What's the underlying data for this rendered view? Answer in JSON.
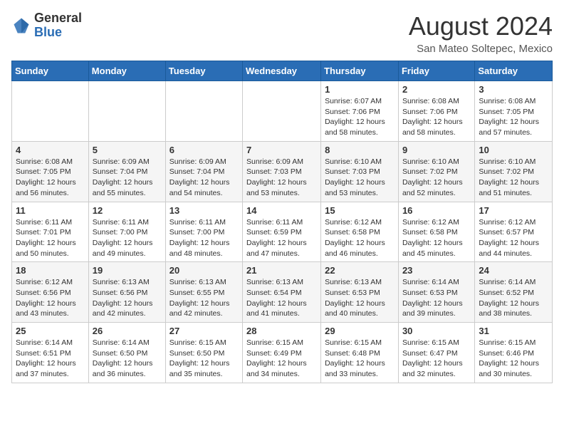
{
  "header": {
    "logo_general": "General",
    "logo_blue": "Blue",
    "month_title": "August 2024",
    "location": "San Mateo Soltepec, Mexico"
  },
  "days_of_week": [
    "Sunday",
    "Monday",
    "Tuesday",
    "Wednesday",
    "Thursday",
    "Friday",
    "Saturday"
  ],
  "weeks": [
    [
      {
        "day": "",
        "info": ""
      },
      {
        "day": "",
        "info": ""
      },
      {
        "day": "",
        "info": ""
      },
      {
        "day": "",
        "info": ""
      },
      {
        "day": "1",
        "info": "Sunrise: 6:07 AM\nSunset: 7:06 PM\nDaylight: 12 hours\nand 58 minutes."
      },
      {
        "day": "2",
        "info": "Sunrise: 6:08 AM\nSunset: 7:06 PM\nDaylight: 12 hours\nand 58 minutes."
      },
      {
        "day": "3",
        "info": "Sunrise: 6:08 AM\nSunset: 7:05 PM\nDaylight: 12 hours\nand 57 minutes."
      }
    ],
    [
      {
        "day": "4",
        "info": "Sunrise: 6:08 AM\nSunset: 7:05 PM\nDaylight: 12 hours\nand 56 minutes."
      },
      {
        "day": "5",
        "info": "Sunrise: 6:09 AM\nSunset: 7:04 PM\nDaylight: 12 hours\nand 55 minutes."
      },
      {
        "day": "6",
        "info": "Sunrise: 6:09 AM\nSunset: 7:04 PM\nDaylight: 12 hours\nand 54 minutes."
      },
      {
        "day": "7",
        "info": "Sunrise: 6:09 AM\nSunset: 7:03 PM\nDaylight: 12 hours\nand 53 minutes."
      },
      {
        "day": "8",
        "info": "Sunrise: 6:10 AM\nSunset: 7:03 PM\nDaylight: 12 hours\nand 53 minutes."
      },
      {
        "day": "9",
        "info": "Sunrise: 6:10 AM\nSunset: 7:02 PM\nDaylight: 12 hours\nand 52 minutes."
      },
      {
        "day": "10",
        "info": "Sunrise: 6:10 AM\nSunset: 7:02 PM\nDaylight: 12 hours\nand 51 minutes."
      }
    ],
    [
      {
        "day": "11",
        "info": "Sunrise: 6:11 AM\nSunset: 7:01 PM\nDaylight: 12 hours\nand 50 minutes."
      },
      {
        "day": "12",
        "info": "Sunrise: 6:11 AM\nSunset: 7:00 PM\nDaylight: 12 hours\nand 49 minutes."
      },
      {
        "day": "13",
        "info": "Sunrise: 6:11 AM\nSunset: 7:00 PM\nDaylight: 12 hours\nand 48 minutes."
      },
      {
        "day": "14",
        "info": "Sunrise: 6:11 AM\nSunset: 6:59 PM\nDaylight: 12 hours\nand 47 minutes."
      },
      {
        "day": "15",
        "info": "Sunrise: 6:12 AM\nSunset: 6:58 PM\nDaylight: 12 hours\nand 46 minutes."
      },
      {
        "day": "16",
        "info": "Sunrise: 6:12 AM\nSunset: 6:58 PM\nDaylight: 12 hours\nand 45 minutes."
      },
      {
        "day": "17",
        "info": "Sunrise: 6:12 AM\nSunset: 6:57 PM\nDaylight: 12 hours\nand 44 minutes."
      }
    ],
    [
      {
        "day": "18",
        "info": "Sunrise: 6:12 AM\nSunset: 6:56 PM\nDaylight: 12 hours\nand 43 minutes."
      },
      {
        "day": "19",
        "info": "Sunrise: 6:13 AM\nSunset: 6:56 PM\nDaylight: 12 hours\nand 42 minutes."
      },
      {
        "day": "20",
        "info": "Sunrise: 6:13 AM\nSunset: 6:55 PM\nDaylight: 12 hours\nand 42 minutes."
      },
      {
        "day": "21",
        "info": "Sunrise: 6:13 AM\nSunset: 6:54 PM\nDaylight: 12 hours\nand 41 minutes."
      },
      {
        "day": "22",
        "info": "Sunrise: 6:13 AM\nSunset: 6:53 PM\nDaylight: 12 hours\nand 40 minutes."
      },
      {
        "day": "23",
        "info": "Sunrise: 6:14 AM\nSunset: 6:53 PM\nDaylight: 12 hours\nand 39 minutes."
      },
      {
        "day": "24",
        "info": "Sunrise: 6:14 AM\nSunset: 6:52 PM\nDaylight: 12 hours\nand 38 minutes."
      }
    ],
    [
      {
        "day": "25",
        "info": "Sunrise: 6:14 AM\nSunset: 6:51 PM\nDaylight: 12 hours\nand 37 minutes."
      },
      {
        "day": "26",
        "info": "Sunrise: 6:14 AM\nSunset: 6:50 PM\nDaylight: 12 hours\nand 36 minutes."
      },
      {
        "day": "27",
        "info": "Sunrise: 6:15 AM\nSunset: 6:50 PM\nDaylight: 12 hours\nand 35 minutes."
      },
      {
        "day": "28",
        "info": "Sunrise: 6:15 AM\nSunset: 6:49 PM\nDaylight: 12 hours\nand 34 minutes."
      },
      {
        "day": "29",
        "info": "Sunrise: 6:15 AM\nSunset: 6:48 PM\nDaylight: 12 hours\nand 33 minutes."
      },
      {
        "day": "30",
        "info": "Sunrise: 6:15 AM\nSunset: 6:47 PM\nDaylight: 12 hours\nand 32 minutes."
      },
      {
        "day": "31",
        "info": "Sunrise: 6:15 AM\nSunset: 6:46 PM\nDaylight: 12 hours\nand 30 minutes."
      }
    ]
  ]
}
